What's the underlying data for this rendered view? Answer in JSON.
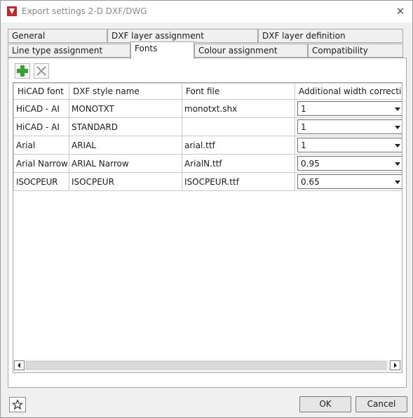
{
  "window": {
    "title": "Export settings 2-D DXF/DWG"
  },
  "tabs_top": [
    "General",
    "DXF layer assignment",
    "DXF layer definition"
  ],
  "tabs_bottom": [
    "Line type assignment",
    "Fonts",
    "Colour assignment",
    "Compatibility"
  ],
  "active_tab": "Fonts",
  "toolbar": {
    "add_icon": "plus-icon",
    "delete_icon": "delete-icon"
  },
  "table": {
    "headers": [
      "HiCAD font",
      "DXF style name",
      "Font file",
      "Additional width correction"
    ],
    "rows": [
      {
        "font": "HiCAD - AI",
        "style": "MONOTXT",
        "file": "monotxt.shx",
        "width": "1"
      },
      {
        "font": "HiCAD - AI",
        "style": "STANDARD",
        "file": "",
        "width": "1"
      },
      {
        "font": "Arial",
        "style": "ARIAL",
        "file": "arial.ttf",
        "width": "1"
      },
      {
        "font": "Arial Narrow",
        "style": "ARIAL Narrow",
        "file": "ArialN.ttf",
        "width": "0.95"
      },
      {
        "font": "ISOCPEUR",
        "style": "ISOCPEUR",
        "file": "ISOCPEUR.ttf",
        "width": "0.65"
      }
    ]
  },
  "buttons": {
    "ok": "OK",
    "cancel": "Cancel"
  },
  "icons": {
    "favorite": "star-icon",
    "close": "close-icon",
    "app": "hicad-app-icon"
  },
  "colors": {
    "add_green": "#3aa335",
    "app_red": "#c8262c"
  }
}
